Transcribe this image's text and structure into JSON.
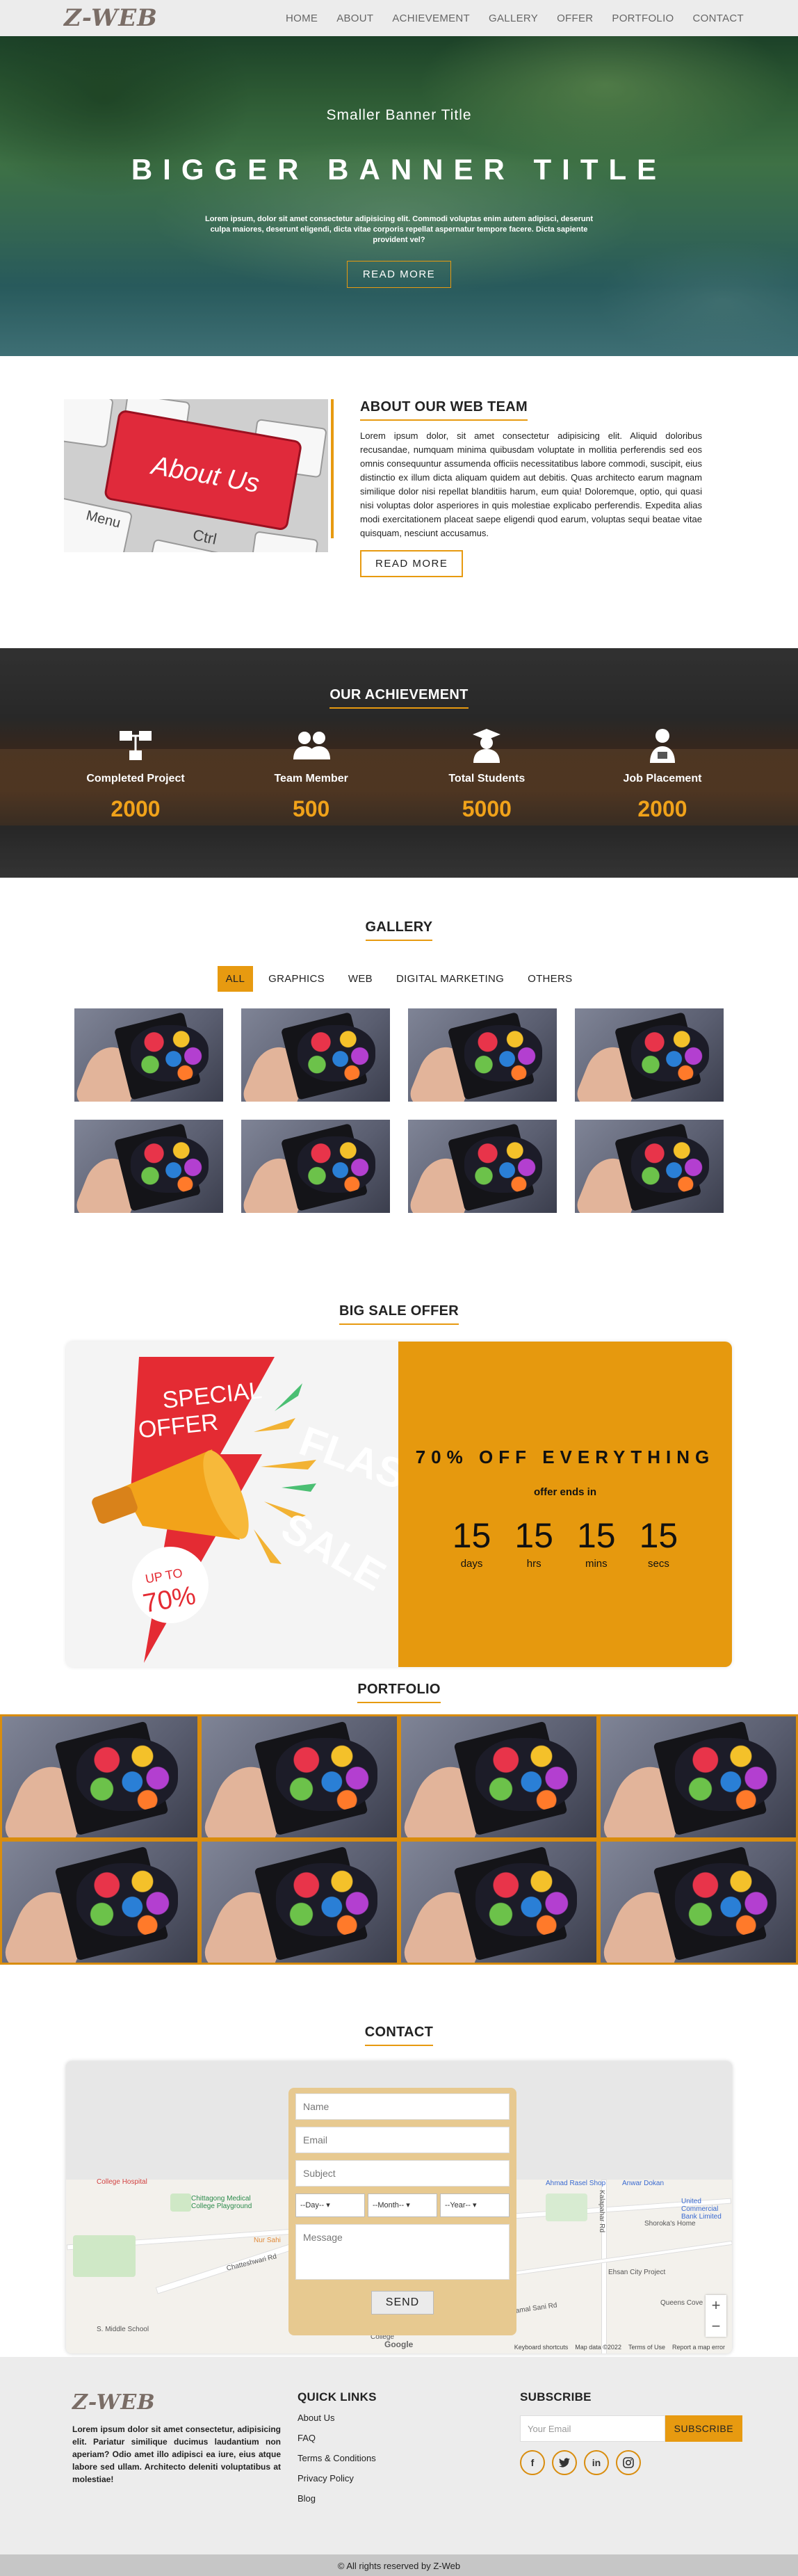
{
  "header": {
    "logo": "Z-WEB",
    "nav": [
      "HOME",
      "ABOUT",
      "ACHIEVEMENT",
      "GALLERY",
      "OFFER",
      "PORTFOLIO",
      "CONTACT"
    ]
  },
  "hero": {
    "subtitle": "Smaller Banner Title",
    "title": "BIGGER BANNER TITLE",
    "text": "Lorem ipsum, dolor sit amet consectetur adipisicing elit. Commodi voluptas enim autem adipisci, deserunt culpa maiores, deserunt eligendi, dicta vitae corporis repellat aspernatur tempore facere. Dicta sapiente provident vel?",
    "button": "READ MORE"
  },
  "about": {
    "image_text": "About Us",
    "key_menu": "Menu",
    "key_ctrl": "Ctrl",
    "title": "ABOUT OUR WEB TEAM",
    "text": "Lorem ipsum dolor, sit amet consectetur adipisicing elit. Aliquid doloribus recusandae, numquam minima quibusdam voluptate in mollitia perferendis sed eos omnis consequuntur assumenda officiis necessitatibus labore commodi, suscipit, eius distinctio ex illum dicta aliquam quidem aut debitis. Quas architecto earum magnam similique dolor nisi repellat blanditiis harum, eum quia! Doloremque, optio, qui quasi nisi voluptas dolor asperiores in quis molestiae explicabo perferendis. Expedita alias modi exercitationem placeat saepe eligendi quod earum, voluptas sequi beatae vitae quisquam, nesciunt accusamus.",
    "button": "READ MORE"
  },
  "achievement": {
    "title": "OUR ACHIEVEMENT",
    "stats": [
      {
        "label": "Completed Project",
        "value": "2000",
        "icon": "sitemap-icon"
      },
      {
        "label": "Team Member",
        "value": "500",
        "icon": "users-icon"
      },
      {
        "label": "Total Students",
        "value": "5000",
        "icon": "graduate-icon"
      },
      {
        "label": "Job Placement",
        "value": "2000",
        "icon": "briefcase-user-icon"
      }
    ]
  },
  "gallery": {
    "title": "GALLERY",
    "filters": [
      "ALL",
      "GRAPHICS",
      "WEB",
      "DIGITAL MARKETING",
      "OTHERS"
    ],
    "active": "ALL"
  },
  "offer": {
    "title": "BIG SALE OFFER",
    "special1": "SPECIAL",
    "special2": "OFFER",
    "flash1": "FLASH",
    "flash2": "SALE",
    "upto": "UP TO",
    "upto_value": "70%",
    "headline": "70% OFF EVERYTHING",
    "ends": "offer ends in",
    "countdown": [
      {
        "n": "15",
        "l": "days"
      },
      {
        "n": "15",
        "l": "hrs"
      },
      {
        "n": "15",
        "l": "mins"
      },
      {
        "n": "15",
        "l": "secs"
      }
    ]
  },
  "portfolio": {
    "title": "PORTFOLIO"
  },
  "contact": {
    "title": "CONTACT",
    "name_ph": "Name",
    "email_ph": "Email",
    "subject_ph": "Subject",
    "day": "--Day--",
    "month": "--Month--",
    "year": "--Year--",
    "message_ph": "Message",
    "send": "SEND",
    "map_labels": [
      "Chittagong Medical College Playground",
      "Chittagong College",
      "Ahmad Rasel Shop",
      "Anwar Dokan",
      "United Commercial Bank Limited",
      "Shoroka's Home",
      "Ehsan City Project",
      "Queens Cove",
      "S. Middle School",
      "Nur Sahi",
      "Chatteshwari Rd",
      "College Hospital",
      "Kalapahar Rd",
      "Kamal Sani Rd"
    ],
    "map_footer": [
      "Keyboard shortcuts",
      "Map data ©2022",
      "Terms of Use",
      "Report a map error"
    ],
    "google": "Google"
  },
  "footer": {
    "logo": "Z-WEB",
    "about": "Lorem ipsum dolor sit amet consectetur, adipisicing elit. Pariatur similique ducimus laudantium non aperiam? Odio amet illo adipisci ea iure, eius atque labore sed ullam. Architecto deleniti voluptatibus at molestiae!",
    "links_title": "QUICK LINKS",
    "links": [
      "About Us",
      "FAQ",
      "Terms & Conditions",
      "Privacy Policy",
      "Blog"
    ],
    "sub_title": "SUBSCRIBE",
    "sub_ph": "Your Email",
    "sub_btn": "SUBSCRIBE",
    "social": [
      "f",
      "t",
      "in",
      "ig"
    ]
  },
  "copyright": "© All rights reserved by Z-Web",
  "colors": {
    "accent": "#e79a10",
    "header_bg": "#ececec",
    "footer_bg": "#ececec",
    "copy_bg": "#c6c6c6"
  }
}
